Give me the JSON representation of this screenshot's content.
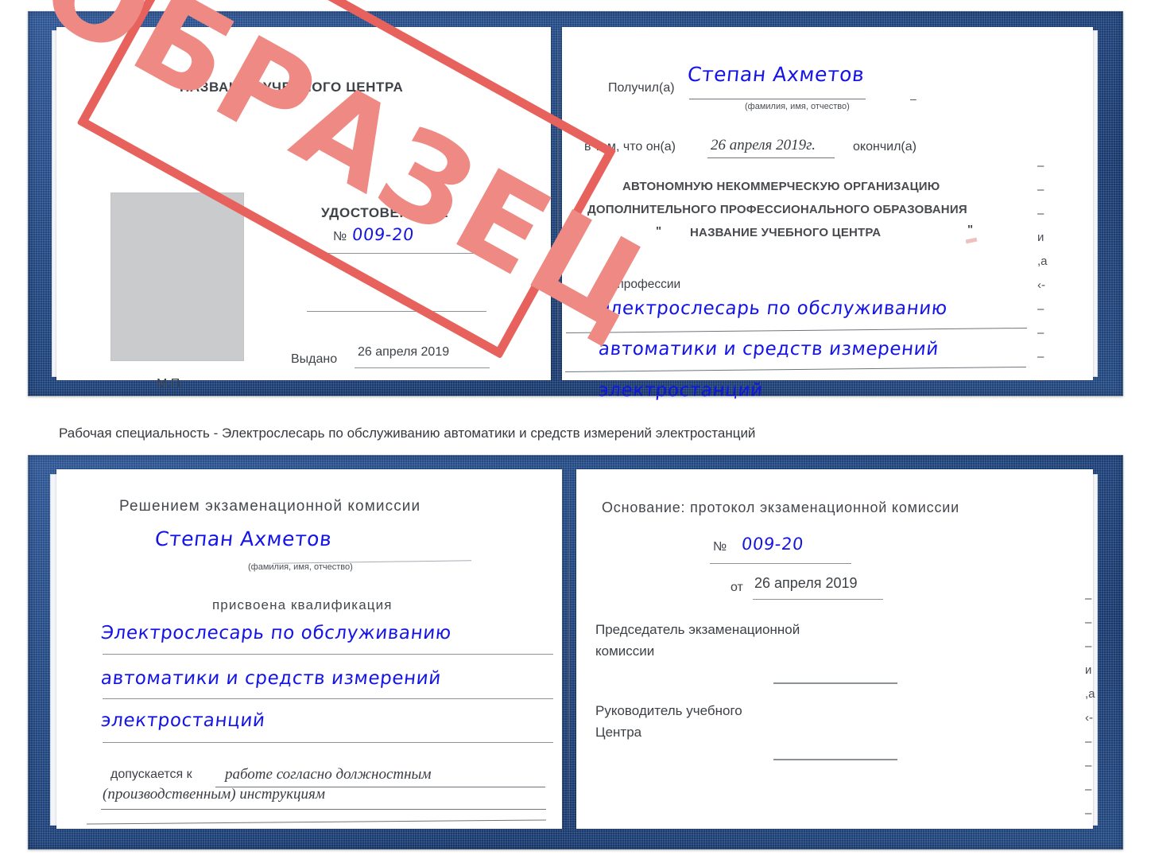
{
  "caption": "Рабочая специальность - Электрослесарь по обслуживанию автоматики и средств измерений электростанций",
  "watermark": {
    "text": "ОБРАЗЕЦ",
    "color": "#e8625d"
  },
  "colors": {
    "cover_blue": "#1f457f",
    "ink_blue": "#1414e6",
    "stamp_red": "#e8625d",
    "photo_gray": "#c9cbcd",
    "rule_gray": "#8d9299"
  },
  "certificate_top": {
    "left_page": {
      "center_name": "НАЗВАНИЕ УЧЕБНОГО ЦЕНТРА",
      "doc_title": "УДОСТОВЕРЕНИЕ",
      "number_label": "№",
      "number_value": "009-20",
      "issued_label": "Выдано",
      "issued_value": "26 апреля 2019",
      "seal_label": "М.П."
    },
    "right_page": {
      "received_label": "Получил(а)",
      "received_value": "Степан Ахметов",
      "received_hint": "(фамилия, имя, отчество)",
      "that_label": "в том, что он(а)",
      "that_value": "26 апреля 2019г.",
      "finished_label": "окончил(а)",
      "org_line1": "АВТОНОМНУЮ НЕКОММЕРЧЕСКУЮ ОРГАНИЗАЦИЮ",
      "org_line2": "ДОПОЛНИТЕЛЬНОГО ПРОФЕССИОНАЛЬНОГО ОБРАЗОВАНИЯ",
      "org_quote_open": "\"",
      "org_line3": "НАЗВАНИЕ УЧЕБНОГО ЦЕНТРА",
      "org_quote_close": "\"",
      "profession_label": "по профессии",
      "profession_line1": "Электрослесарь по обслуживанию",
      "profession_line2": "автоматики и средств измерений",
      "profession_line3": "электростанций",
      "edge_glyphs": [
        "–",
        "–",
        "–",
        "и",
        ",а",
        "‹-",
        "–",
        "–",
        "–",
        "–"
      ]
    }
  },
  "certificate_bottom": {
    "left_page": {
      "decision_title": "Решением экзаменационной комиссии",
      "name_value": "Степан Ахметов",
      "name_hint": "(фамилия, имя, отчество)",
      "qualification_label": "присвоена квалификация",
      "qualification_line1": "Электрослесарь по обслуживанию",
      "qualification_line2": "автоматики и средств измерений",
      "qualification_line3": "электростанций",
      "admitted_label": "допускается к",
      "admitted_line1": "работе согласно должностным",
      "admitted_line2": "(производственным) инструкциям"
    },
    "right_page": {
      "basis_label": "Основание: протокол экзаменационной комиссии",
      "number_label": "№",
      "number_value": "009-20",
      "date_label": "от",
      "date_value": "26 апреля 2019",
      "chairman_line1": "Председатель экзаменационной",
      "chairman_line2": "комиссии",
      "director_line1": "Руководитель учебного",
      "director_line2": "Центра",
      "edge_glyphs": [
        "–",
        "–",
        "–",
        "и",
        ",а",
        "‹-",
        "–",
        "–",
        "–",
        "–"
      ]
    }
  }
}
